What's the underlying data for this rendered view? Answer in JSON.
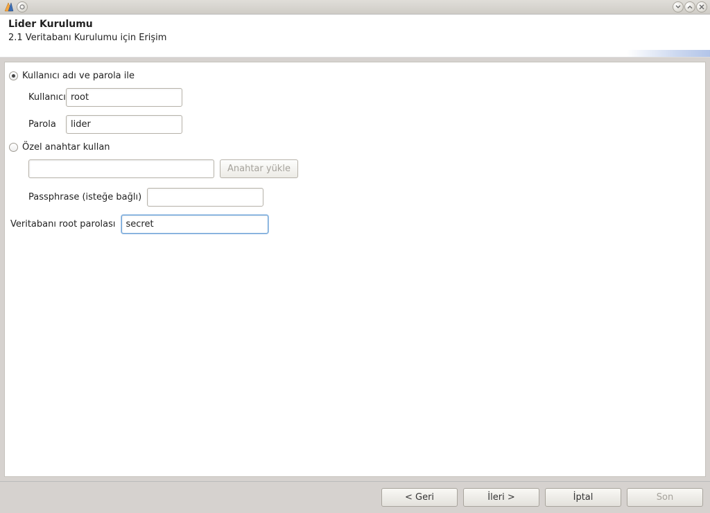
{
  "window": {
    "minimize_hint": "minimize",
    "maximize_hint": "maximize",
    "close_hint": "close"
  },
  "header": {
    "title": "Lider Kurulumu",
    "subtitle": "2.1 Veritabanı Kurulumu için Erişim"
  },
  "form": {
    "radio_userpass": "Kullanıcı adı ve parola ile",
    "radio_key": "Özel anahtar kullan",
    "username_label": "Kullanıcı Adı",
    "username_value": "root",
    "password_label": "Parola",
    "password_value": "lider",
    "key_load_btn": "Anahtar yükle",
    "passphrase_label": "Passphrase (isteğe bağlı)",
    "root_pass_label": "Veritabanı root parolası",
    "root_pass_value": "secret"
  },
  "footer": {
    "back": "< Geri",
    "next": "İleri >",
    "cancel": "İptal",
    "finish": "Son"
  }
}
